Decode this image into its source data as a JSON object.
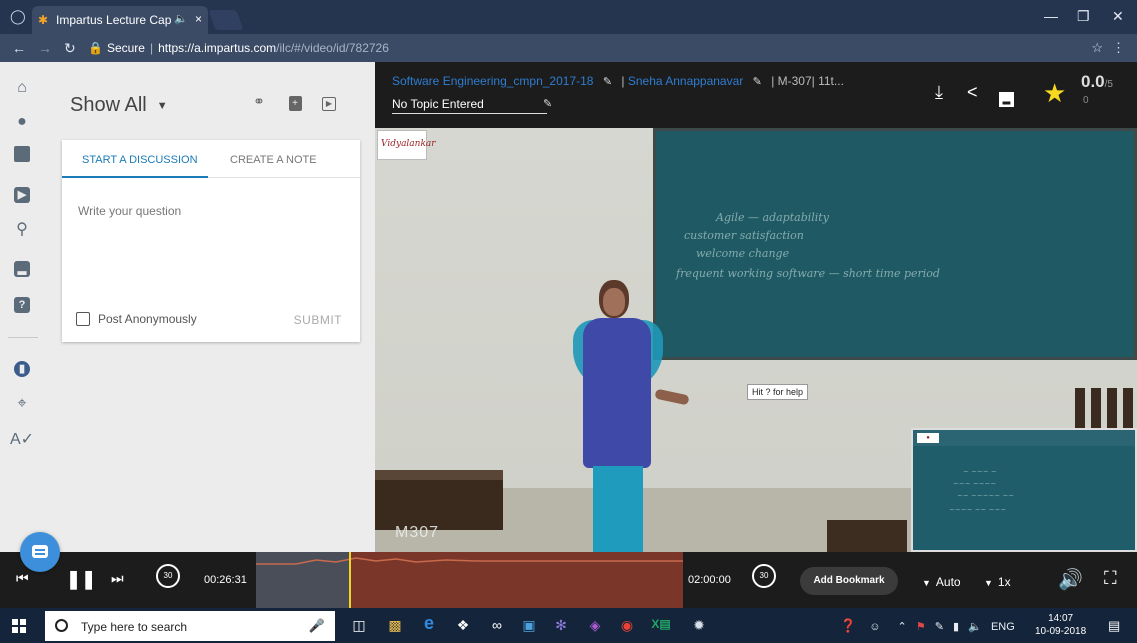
{
  "browser": {
    "tab_title": "Impartus Lecture Cap",
    "tab_audio_icon": "speaker-icon",
    "tab_close": "×",
    "secure_label": "Secure",
    "url_host": "https://a.impartus.com",
    "url_path": "/ilc/#/video/id/782726"
  },
  "left_panel": {
    "filter_label": "Show All",
    "tabs": [
      "START A DISCUSSION",
      "CREATE A NOTE"
    ],
    "question_placeholder": "Write your question",
    "anonymous_label": "Post Anonymously",
    "submit_label": "SUBMIT"
  },
  "video_header": {
    "course": "Software Engineering_cmpn_2017-18",
    "instructor": "Sneha Annappanavar",
    "rest": "| M-307| 11t...",
    "separator": "|",
    "topic": "No Topic Entered",
    "rating": "0.0",
    "rating_max": "/5",
    "votes": "0"
  },
  "video": {
    "logo_text": "Vidyalankar",
    "room_label": "M307",
    "tooltip": "Hit ? for help",
    "board_notes": [
      "Agile — adaptability",
      "customer satisfaction",
      "welcome change",
      "frequent working software — short time period"
    ]
  },
  "controls": {
    "elapsed": "00:26:31",
    "total": "02:00:00",
    "skip_back_seconds": "30",
    "skip_forward_seconds": "30",
    "bookmark_label": "Add Bookmark",
    "quality_label": "Auto",
    "speed_label": "1x",
    "progress_fraction": 0.2208
  },
  "taskbar": {
    "search_placeholder": "Type here to search",
    "tray_lang": "ENG",
    "time": "14:07",
    "date": "10-09-2018"
  },
  "colors": {
    "accent_blue": "#1b7bb6",
    "link_blue": "#2e7dd1",
    "star_yellow": "#f8d91e",
    "progress_played": "#4a4e58",
    "progress_remaining": "#7b362a",
    "playhead": "#f0d327"
  }
}
